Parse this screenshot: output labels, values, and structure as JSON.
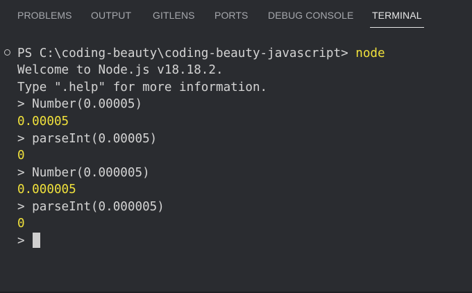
{
  "tabs": [
    {
      "label": "PROBLEMS",
      "active": false
    },
    {
      "label": "OUTPUT",
      "active": false
    },
    {
      "label": "GITLENS",
      "active": false
    },
    {
      "label": "PORTS",
      "active": false
    },
    {
      "label": "DEBUG CONSOLE",
      "active": false
    },
    {
      "label": "TERMINAL",
      "active": true
    }
  ],
  "terminal": {
    "prompt_path": "PS C:\\coding-beauty\\coding-beauty-javascript> ",
    "command": "node",
    "welcome": "Welcome to Node.js v18.18.2.",
    "help": "Type \".help\" for more information.",
    "entries": [
      {
        "input": "> Number(0.00005)",
        "output": "0.00005"
      },
      {
        "input": "> parseInt(0.00005)",
        "output": "0"
      },
      {
        "input": "> Number(0.000005)",
        "output": "0.000005"
      },
      {
        "input": "> parseInt(0.000005)",
        "output": "0"
      }
    ],
    "current_prompt": "> "
  },
  "colors": {
    "background": "#2a2c30",
    "text": "#d4d4d4",
    "highlight": "#f0e13c",
    "tab_inactive": "#a6a8ad",
    "tab_active": "#e7e7e7"
  }
}
